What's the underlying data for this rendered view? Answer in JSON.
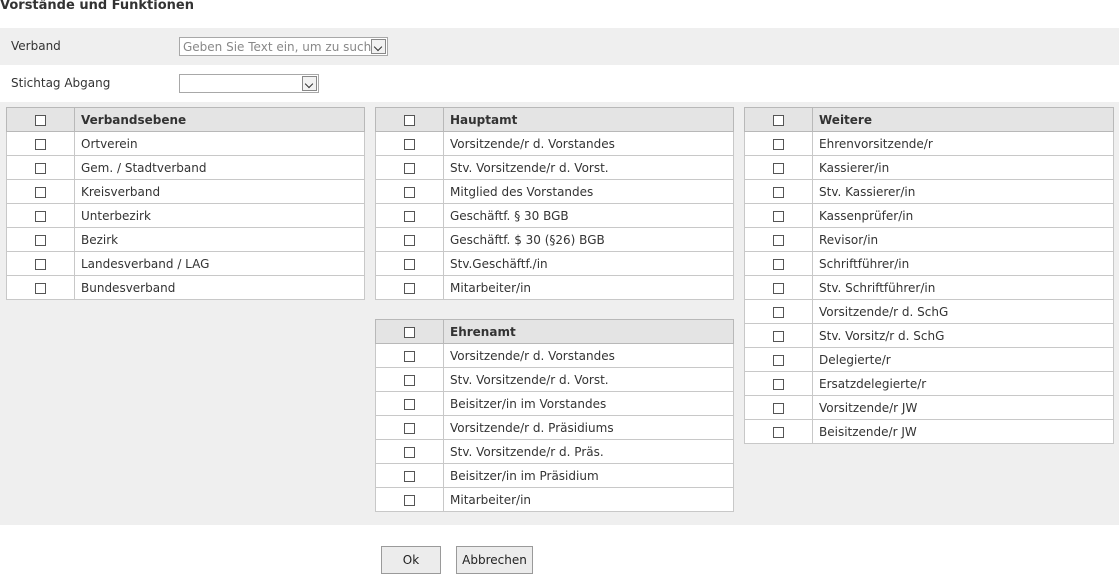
{
  "title": "Vorstände und Funktionen",
  "verband": {
    "label": "Verband",
    "placeholder": "Geben Sie Text ein, um zu suchen"
  },
  "stichtag": {
    "label": "Stichtag Abgang",
    "value": ""
  },
  "groups": {
    "verbandsebene": {
      "header": "Verbandsebene",
      "items": [
        "Ortverein",
        "Gem. / Stadtverband",
        "Kreisverband",
        "Unterbezirk",
        "Bezirk",
        "Landesverband / LAG",
        "Bundesverband"
      ]
    },
    "hauptamt": {
      "header": "Hauptamt",
      "items": [
        "Vorsitzende/r d. Vorstandes",
        "Stv. Vorsitzende/r d. Vorst.",
        "Mitglied des Vorstandes",
        "Geschäftf. § 30 BGB",
        "Geschäftf. $ 30 (§26) BGB",
        "Stv.Geschäftf./in",
        "Mitarbeiter/in"
      ]
    },
    "ehrenamt": {
      "header": "Ehrenamt",
      "items": [
        "Vorsitzende/r d. Vorstandes",
        "Stv. Vorsitzende/r d. Vorst.",
        "Beisitzer/in im Vorstandes",
        "Vorsitzende/r d. Präsidiums",
        "Stv. Vorsitzende/r d. Präs.",
        "Beisitzer/in im Präsidium",
        "Mitarbeiter/in"
      ]
    },
    "weitere": {
      "header": "Weitere",
      "items": [
        "Ehrenvorsitzende/r",
        "Kassierer/in",
        "Stv. Kassierer/in",
        "Kassenprüfer/in",
        "Revisor/in",
        "Schriftführer/in",
        "Stv. Schriftführer/in",
        "Vorsitzende/r d. SchG",
        "Stv. Vorsitz/r d. SchG",
        "Delegierte/r",
        "Ersatzdelegierte/r",
        "Vorsitzende/r JW",
        "Beisitzende/r JW"
      ]
    }
  },
  "buttons": {
    "ok": "Ok",
    "cancel": "Abbrechen"
  }
}
